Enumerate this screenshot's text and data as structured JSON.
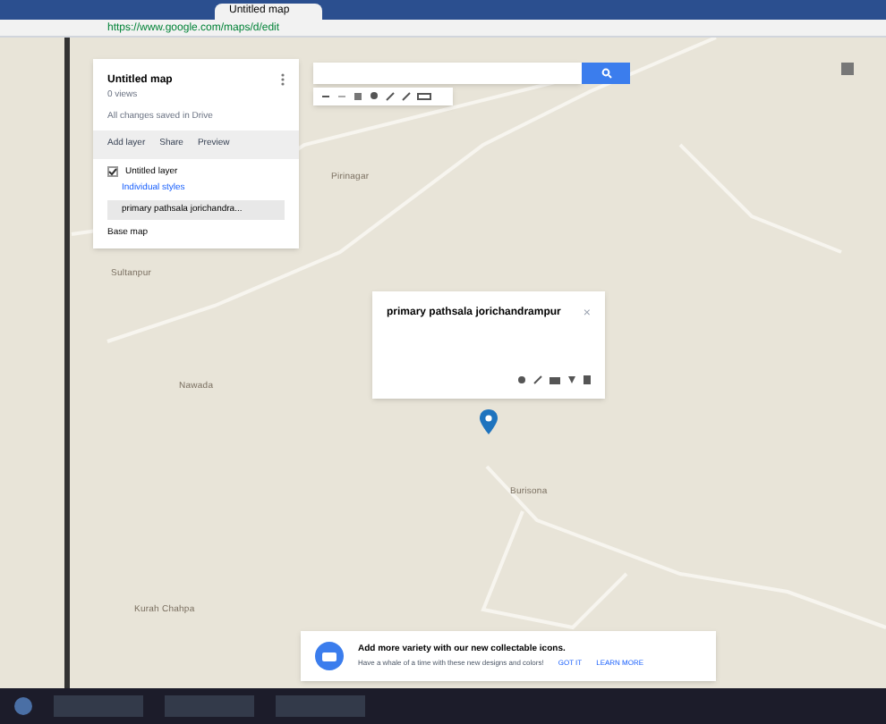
{
  "browser": {
    "active_tab": "Untitled map",
    "url": "https://www.google.com/maps/d/edit"
  },
  "map_panel": {
    "title": "Untitled map",
    "views": "0 views",
    "saved": "All changes saved in Drive",
    "actions": [
      "Add layer",
      "Share",
      "Preview"
    ],
    "layer": {
      "name": "Untitled layer",
      "checked": true,
      "style": "Individual styles",
      "places": [
        {
          "label": "primary pathsala jorichandra...",
          "selected": true
        }
      ]
    },
    "base_map": "Base map"
  },
  "place_labels": [
    {
      "label": "Sultanpur",
      "kind": "town"
    },
    {
      "label": "Nawada",
      "kind": "town"
    },
    {
      "label": "Pirinagar",
      "kind": "town"
    },
    {
      "label": "Burisona",
      "kind": "town"
    },
    {
      "label": "Kurah Chahpa",
      "kind": "town"
    }
  ],
  "info_window": {
    "title": "primary pathsala jorichandrampur",
    "close": "×"
  },
  "banner": {
    "title": "Add more variety with our new collectable icons.",
    "text": "Have a whale of a time with these new designs and colors!",
    "actions": [
      "GOT IT",
      "LEARN MORE"
    ]
  }
}
